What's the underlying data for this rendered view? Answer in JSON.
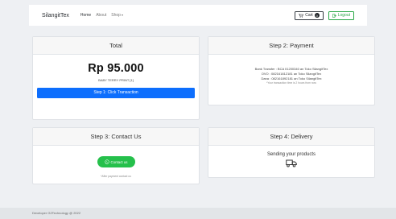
{
  "navbar": {
    "brand": "SilangitTex",
    "links": [
      {
        "label": "Home"
      },
      {
        "label": "About"
      },
      {
        "label": "Shop"
      }
    ],
    "cart_label": "Cart",
    "cart_count": "0",
    "logout_label": "Logout"
  },
  "total": {
    "header": "Total",
    "price": "Rp 95.000",
    "product": "BABY TERRY PRINT [1]",
    "button": "Step 1: Click Transaction"
  },
  "payment": {
    "header": "Step 2: Payment",
    "lines": [
      "Bank Transfer : BCA 01200340 an Toko SilangitTex",
      "OVO : 082161812181 an Toko SilangitTex",
      "Dana : 082161892181 an Toko SilangitTex"
    ],
    "note": "*Your transaction time is 2 hours from now"
  },
  "contact": {
    "header": "Step 3: Contact Us",
    "button": "Contact us",
    "note": "*After payment contact us"
  },
  "delivery": {
    "header": "Step 4: Delivery",
    "text": "Sending your products"
  },
  "footer": {
    "text": "Developer G2Technology @ 2022"
  },
  "colors": {
    "primary": "#0d6efd",
    "success": "#28a745",
    "whatsapp": "#25c04b"
  },
  "icons": [
    "cart-icon",
    "logout-icon",
    "whatsapp-icon",
    "truck-icon"
  ]
}
